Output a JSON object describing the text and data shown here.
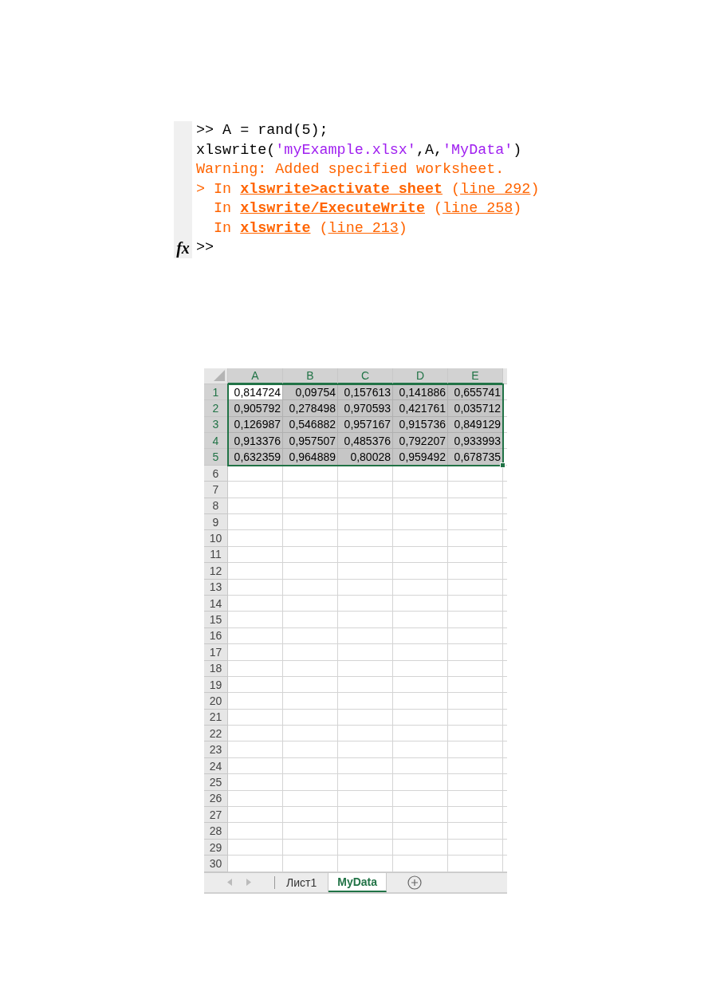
{
  "console": {
    "lines": [
      {
        "segments": [
          {
            "kind": "code",
            "text": ">> A = rand(5);"
          }
        ]
      },
      {
        "segments": [
          {
            "kind": "code",
            "text": "xlswrite("
          },
          {
            "kind": "string",
            "text": "'myExample.xlsx'"
          },
          {
            "kind": "code",
            "text": ",A,"
          },
          {
            "kind": "string",
            "text": "'MyData'"
          },
          {
            "kind": "code",
            "text": ")"
          }
        ]
      },
      {
        "segments": [
          {
            "kind": "warning",
            "text": "Warning: Added specified worksheet."
          }
        ]
      },
      {
        "segments": [
          {
            "kind": "warning",
            "text": "> In "
          },
          {
            "kind": "bold_link",
            "text": "xlswrite>activate_sheet"
          },
          {
            "kind": "warning",
            "text": " ("
          },
          {
            "kind": "link",
            "text": "line 292"
          },
          {
            "kind": "warning",
            "text": ")"
          }
        ]
      },
      {
        "segments": [
          {
            "kind": "warning",
            "text": "  In "
          },
          {
            "kind": "bold_link",
            "text": "xlswrite/ExecuteWrite"
          },
          {
            "kind": "warning",
            "text": " ("
          },
          {
            "kind": "link",
            "text": "line 258"
          },
          {
            "kind": "warning",
            "text": ")"
          }
        ]
      },
      {
        "segments": [
          {
            "kind": "warning",
            "text": "  In "
          },
          {
            "kind": "bold_link",
            "text": "xlswrite"
          },
          {
            "kind": "warning",
            "text": " ("
          },
          {
            "kind": "link",
            "text": "line 213"
          },
          {
            "kind": "warning",
            "text": ")"
          }
        ]
      }
    ],
    "prompt_button": "fx",
    "prompt": ">>"
  },
  "sheet": {
    "columns": [
      "A",
      "B",
      "C",
      "D",
      "E"
    ],
    "rows": [
      {
        "label": "1",
        "cells": [
          {
            "text": "0,814724",
            "selected": true,
            "active": true
          },
          {
            "text": "0,09754",
            "selected": true,
            "active": false
          },
          {
            "text": "0,157613",
            "selected": true,
            "active": false
          },
          {
            "text": "0,141886",
            "selected": true,
            "active": false
          },
          {
            "text": "0,655741",
            "selected": true,
            "active": false
          }
        ]
      },
      {
        "label": "2",
        "cells": [
          {
            "text": "0,905792",
            "selected": true,
            "active": false
          },
          {
            "text": "0,278498",
            "selected": true,
            "active": false
          },
          {
            "text": "0,970593",
            "selected": true,
            "active": false
          },
          {
            "text": "0,421761",
            "selected": true,
            "active": false
          },
          {
            "text": "0,035712",
            "selected": true,
            "active": false
          }
        ]
      },
      {
        "label": "3",
        "cells": [
          {
            "text": "0,126987",
            "selected": true,
            "active": false
          },
          {
            "text": "0,546882",
            "selected": true,
            "active": false
          },
          {
            "text": "0,957167",
            "selected": true,
            "active": false
          },
          {
            "text": "0,915736",
            "selected": true,
            "active": false
          },
          {
            "text": "0,849129",
            "selected": true,
            "active": false
          }
        ]
      },
      {
        "label": "4",
        "cells": [
          {
            "text": "0,913376",
            "selected": true,
            "active": false
          },
          {
            "text": "0,957507",
            "selected": true,
            "active": false
          },
          {
            "text": "0,485376",
            "selected": true,
            "active": false
          },
          {
            "text": "0,792207",
            "selected": true,
            "active": false
          },
          {
            "text": "0,933993",
            "selected": true,
            "active": false
          }
        ]
      },
      {
        "label": "5",
        "cells": [
          {
            "text": "0,632359",
            "selected": true,
            "active": false
          },
          {
            "text": "0,964889",
            "selected": true,
            "active": false
          },
          {
            "text": "0,80028",
            "selected": true,
            "active": false
          },
          {
            "text": "0,959492",
            "selected": true,
            "active": false
          },
          {
            "text": "0,678735",
            "selected": true,
            "active": false
          }
        ]
      },
      {
        "label": "6"
      },
      {
        "label": "7"
      },
      {
        "label": "8"
      },
      {
        "label": "9"
      },
      {
        "label": "10"
      },
      {
        "label": "11"
      },
      {
        "label": "12"
      },
      {
        "label": "13"
      },
      {
        "label": "14"
      },
      {
        "label": "15"
      },
      {
        "label": "16"
      },
      {
        "label": "17"
      },
      {
        "label": "18"
      },
      {
        "label": "19"
      },
      {
        "label": "20"
      },
      {
        "label": "21"
      },
      {
        "label": "22"
      },
      {
        "label": "23"
      },
      {
        "label": "24"
      },
      {
        "label": "25"
      },
      {
        "label": "26"
      },
      {
        "label": "27"
      },
      {
        "label": "28"
      },
      {
        "label": "29"
      },
      {
        "label": "30"
      }
    ],
    "tabs": [
      {
        "label": "Лист1",
        "selected": false
      },
      {
        "label": "MyData",
        "selected": true
      }
    ]
  }
}
